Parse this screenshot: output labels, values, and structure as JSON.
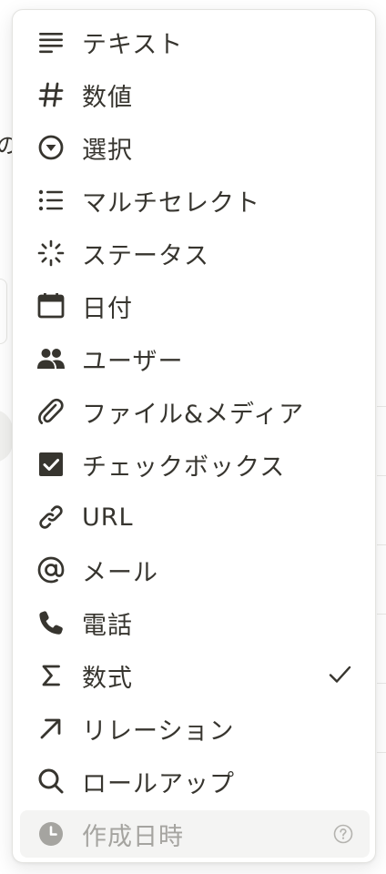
{
  "background": {
    "partial_glyph": "の"
  },
  "menu": {
    "items": [
      {
        "label": "テキスト",
        "icon": "text-lines-icon"
      },
      {
        "label": "数値",
        "icon": "hash-icon"
      },
      {
        "label": "選択",
        "icon": "select-circle-icon"
      },
      {
        "label": "マルチセレクト",
        "icon": "bulleted-list-icon"
      },
      {
        "label": "ステータス",
        "icon": "status-loader-icon"
      },
      {
        "label": "日付",
        "icon": "calendar-icon"
      },
      {
        "label": "ユーザー",
        "icon": "people-icon"
      },
      {
        "label": "ファイル&メディア",
        "icon": "paperclip-icon"
      },
      {
        "label": "チェックボックス",
        "icon": "checkbox-icon"
      },
      {
        "label": "URL",
        "icon": "link-icon"
      },
      {
        "label": "メール",
        "icon": "at-sign-icon"
      },
      {
        "label": "電話",
        "icon": "phone-icon"
      },
      {
        "label": "数式",
        "icon": "sigma-icon",
        "selected": true
      },
      {
        "label": "リレーション",
        "icon": "arrow-up-right-icon"
      },
      {
        "label": "ロールアップ",
        "icon": "magnifier-icon"
      },
      {
        "label": "作成日時",
        "icon": "clock-icon",
        "disabled": true
      }
    ]
  },
  "colors": {
    "text": "#37352f",
    "disabled_text": "#a5a4a0",
    "disabled_background": "#f4f4f3",
    "menu_border": "#e3e3e0"
  }
}
